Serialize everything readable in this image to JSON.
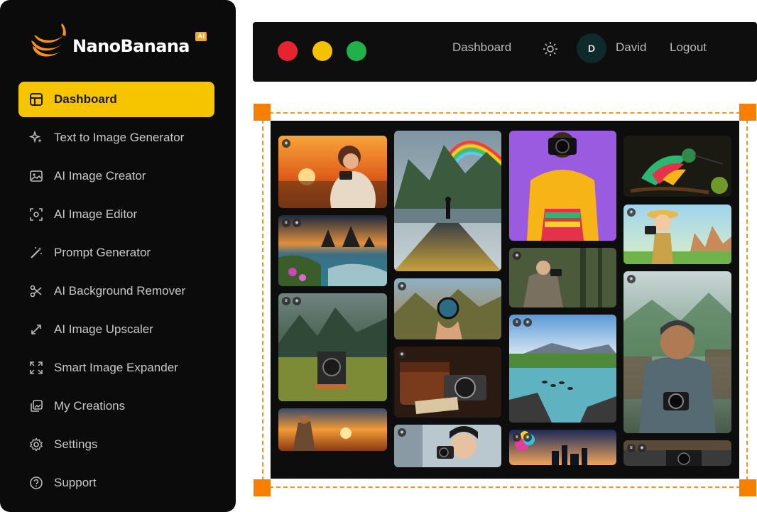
{
  "app": {
    "name": "NanoBanana",
    "badge": "AI"
  },
  "sidebar": {
    "items": [
      {
        "label": "Dashboard",
        "icon": "layout-icon",
        "active": true
      },
      {
        "label": "Text to Image Generator",
        "icon": "sparkles-icon",
        "active": false
      },
      {
        "label": "AI Image Creator",
        "icon": "image-icon",
        "active": false
      },
      {
        "label": "AI Image Editor",
        "icon": "focus-icon",
        "active": false
      },
      {
        "label": "Prompt Generator",
        "icon": "magic-wand-icon",
        "active": false
      },
      {
        "label": "AI Background Remover",
        "icon": "scissors-icon",
        "active": false
      },
      {
        "label": "AI Image Upscaler",
        "icon": "expand-arrows-icon",
        "active": false
      },
      {
        "label": "Smart Image Expander",
        "icon": "expand-corners-icon",
        "active": false
      },
      {
        "label": "My Creations",
        "icon": "gallery-icon",
        "active": false
      },
      {
        "label": "Settings",
        "icon": "gear-icon",
        "active": false
      },
      {
        "label": "Support",
        "icon": "help-circle-icon",
        "active": false
      }
    ]
  },
  "topbar": {
    "window_controls": [
      "close",
      "minimize",
      "maximize"
    ],
    "dashboard_link": "Dashboard",
    "theme_icon": "sun-icon",
    "avatar_initial": "D",
    "username": "David",
    "logout": "Logout"
  },
  "colors": {
    "accent": "#f7c400",
    "frame": "#f7931e",
    "sidebar_bg": "#0b0b0b"
  },
  "gallery": {
    "images": [
      {
        "name": "woman-camera-sunset",
        "column": 1
      },
      {
        "name": "coastal-rocks-sunset",
        "column": 1
      },
      {
        "name": "vintage-camera-meadow",
        "column": 1
      },
      {
        "name": "hiker-photographing-sunset",
        "column": 1
      },
      {
        "name": "rainbow-mountain-road",
        "column": 2
      },
      {
        "name": "lens-ball-valley",
        "column": 2
      },
      {
        "name": "leather-bag-cameras",
        "column": 2
      },
      {
        "name": "smiling-woman-camera",
        "column": 2
      },
      {
        "name": "yellow-jacket-photographer",
        "column": 3
      },
      {
        "name": "woman-camera-forest",
        "column": 3
      },
      {
        "name": "river-ducks-landscape",
        "column": 3
      },
      {
        "name": "colorful-city-skyline",
        "column": 3
      },
      {
        "name": "colorful-hummingbird",
        "column": 4
      },
      {
        "name": "cartoon-explorer-camera",
        "column": 4
      },
      {
        "name": "man-with-camera-village",
        "column": 4
      },
      {
        "name": "camera-on-table",
        "column": 4
      }
    ]
  }
}
